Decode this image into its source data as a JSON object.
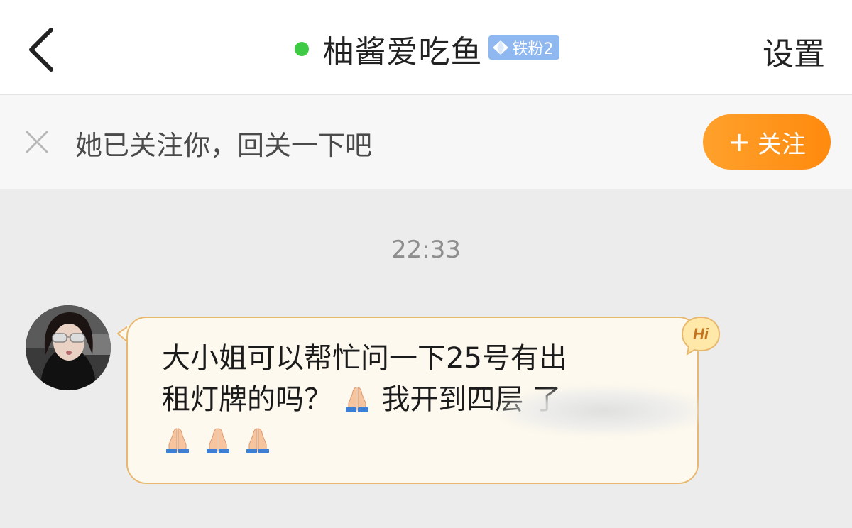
{
  "header": {
    "title": "柚酱爱吃鱼",
    "badge_label": "铁粉2",
    "settings_label": "设置"
  },
  "follow_prompt": {
    "text": "她已关注你，回关一下吧",
    "button_label": "关注",
    "button_plus": "+"
  },
  "chat": {
    "timestamp": "22:33",
    "message": {
      "line1": "大小姐可以帮忙问一下25号有出",
      "line2_before_emoji": "租灯牌的吗？",
      "line2_after_emoji": "我开到四层",
      "line2_end": "了"
    },
    "hi_badge": "Hi"
  },
  "icons": {
    "back": "chevron-left-icon",
    "close": "close-icon",
    "online": "online-status-dot",
    "fan": "diamond-icon",
    "emoji": "folded-hands-emoji"
  },
  "colors": {
    "accent_orange": "#ff8a0e",
    "online_green": "#3fca45",
    "badge_blue": "#8fb8f0",
    "bubble_bg": "#fdf9ee",
    "bubble_border": "#e9b86f"
  }
}
